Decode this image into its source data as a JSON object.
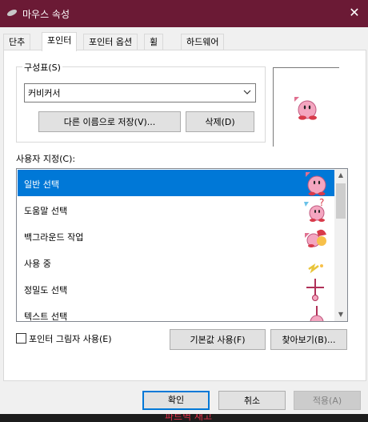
{
  "window": {
    "title": "마우스 속성",
    "close_glyph": "✕"
  },
  "tabs": [
    {
      "label": "단추"
    },
    {
      "label": "포인터"
    },
    {
      "label": "포인터 옵션"
    },
    {
      "label": "휠"
    },
    {
      "label": "하드웨어"
    }
  ],
  "active_tab": "포인터",
  "scheme": {
    "group_label": "구성표(S)",
    "selected": "커비커서",
    "save_as_label": "다른 이름으로 저장(V)...",
    "delete_label": "삭제(D)"
  },
  "customize": {
    "label": "사용자 지정(C):",
    "items": [
      {
        "label": "일반 선택",
        "icon": "kirby-normal-cursor-icon",
        "selected": true
      },
      {
        "label": "도움말 선택",
        "icon": "kirby-help-cursor-icon"
      },
      {
        "label": "백그라운드 작업",
        "icon": "kirby-working-cursor-icon"
      },
      {
        "label": "사용 중",
        "icon": "busy-cursor-icon"
      },
      {
        "label": "정밀도 선택",
        "icon": "precision-cursor-icon"
      },
      {
        "label": "텍스트 선택",
        "icon": "text-cursor-icon"
      }
    ]
  },
  "shadow": {
    "label": "포인터 그림자 사용(E)",
    "checked": false
  },
  "actions": {
    "default_label": "기본값 사용(F)",
    "browse_label": "찾아보기(B)..."
  },
  "footer": {
    "ok_label": "확인",
    "cancel_label": "취소",
    "apply_label": "적용(A)"
  },
  "taskbar": {
    "text": "파트벽 재고"
  },
  "colors": {
    "titlebar": "#6b1a35",
    "selection": "#0078d7",
    "kirby_pink": "#f4a6c0"
  }
}
